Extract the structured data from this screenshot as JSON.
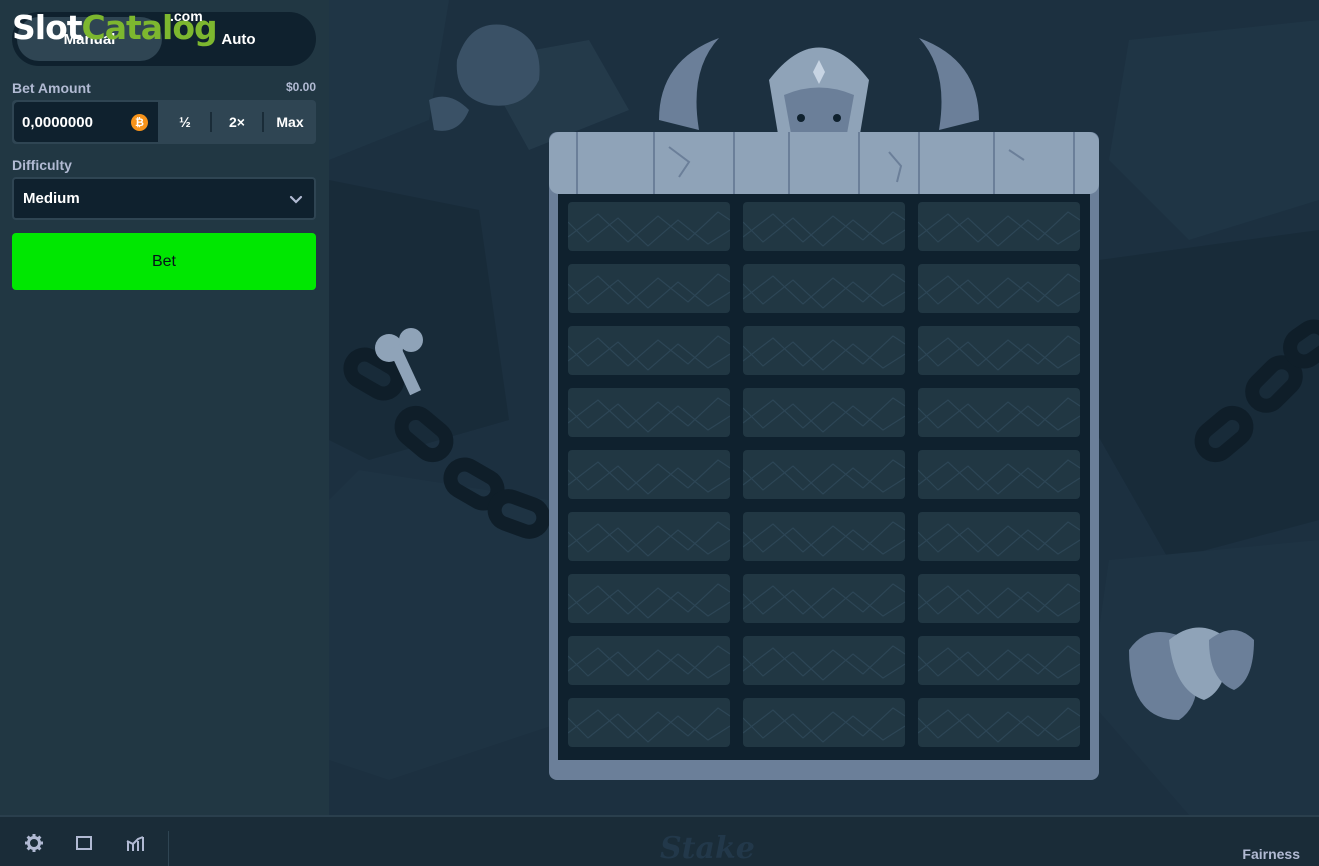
{
  "watermark": {
    "slot": "Slot",
    "catalog": "Catalog",
    "com": ".com"
  },
  "mode": {
    "manual_label": "Manual",
    "auto_label": "Auto",
    "active": "manual"
  },
  "bet": {
    "label": "Bet Amount",
    "usd_value": "$0.00",
    "amount": "0,0000000",
    "currency_icon": "bitcoin-icon",
    "currency_symbol": "₿",
    "half_label": "½",
    "double_label": "2×",
    "max_label": "Max"
  },
  "difficulty": {
    "label": "Difficulty",
    "selected": "Medium"
  },
  "bet_button": {
    "label": "Bet",
    "color": "#00e701"
  },
  "tower": {
    "rows": 9,
    "columns": 3
  },
  "footer": {
    "icons": [
      "settings-icon",
      "theatre-mode-icon",
      "live-stats-icon"
    ],
    "logo": "Stake",
    "fairness_label": "Fairness"
  },
  "colors": {
    "sidebar": "#213743",
    "background": "#1a2c38",
    "input": "#0f212e",
    "accent": "#00e701"
  }
}
